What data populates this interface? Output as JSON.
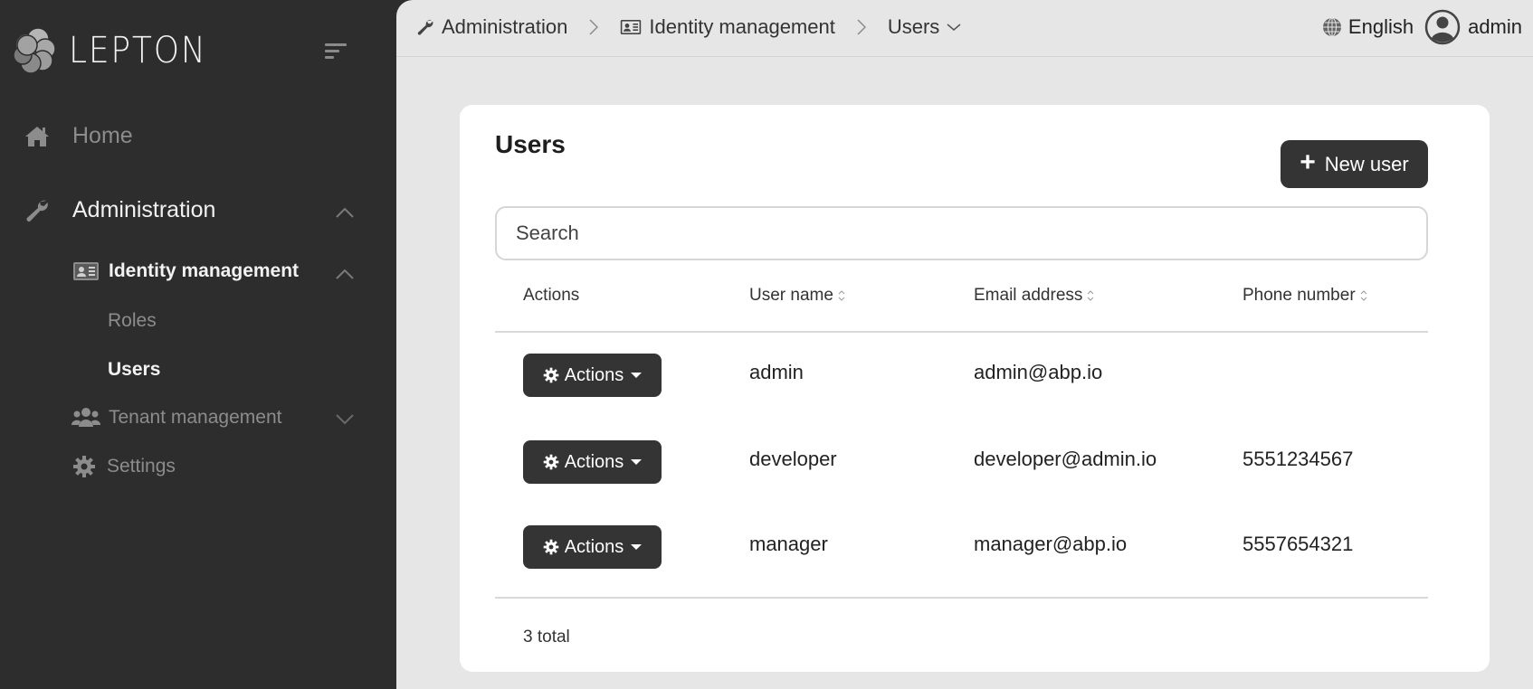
{
  "brand": {
    "name": "LEPTON"
  },
  "sidebar": {
    "items": [
      {
        "label": "Home",
        "icon": "home-icon"
      },
      {
        "label": "Administration",
        "icon": "wrench-icon",
        "expanded": true,
        "children": [
          {
            "label": "Identity management",
            "icon": "id-card-icon",
            "expanded": true,
            "children": [
              {
                "label": "Roles",
                "active": false
              },
              {
                "label": "Users",
                "active": true
              }
            ]
          },
          {
            "label": "Tenant management",
            "icon": "users-icon",
            "expanded": false
          },
          {
            "label": "Settings",
            "icon": "gear-icon"
          }
        ]
      }
    ]
  },
  "topbar": {
    "breadcrumb": [
      {
        "label": "Administration",
        "icon": "wrench-icon"
      },
      {
        "label": "Identity management",
        "icon": "id-card-icon"
      },
      {
        "label": "Users",
        "icon": "chevron-down-icon"
      }
    ],
    "language": "English",
    "username": "admin"
  },
  "page": {
    "title": "Users",
    "new_user_label": "New user",
    "search_placeholder": "Search",
    "search_value": ""
  },
  "table": {
    "columns": [
      {
        "label": "Actions",
        "sortable": false
      },
      {
        "label": "User name",
        "sortable": true
      },
      {
        "label": "Email address",
        "sortable": true
      },
      {
        "label": "Phone number",
        "sortable": true
      }
    ],
    "rows": [
      {
        "action_label": "Actions",
        "username": "admin",
        "email": "admin@abp.io",
        "phone": ""
      },
      {
        "action_label": "Actions",
        "username": "developer",
        "email": "developer@admin.io",
        "phone": "5551234567"
      },
      {
        "action_label": "Actions",
        "username": "manager",
        "email": "manager@abp.io",
        "phone": "5557654321"
      }
    ],
    "total_label": "3 total"
  },
  "colors": {
    "sidebar_bg": "#2d2d2d",
    "main_bg": "#e6e6e6",
    "button_bg": "#343434",
    "card_bg": "#ffffff"
  }
}
